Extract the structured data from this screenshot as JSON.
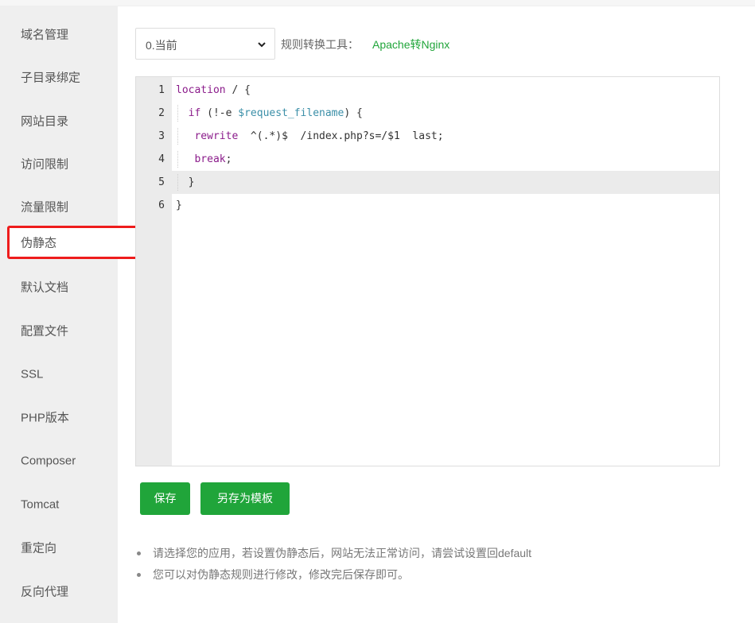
{
  "sidebar": {
    "items": [
      {
        "label": "域名管理"
      },
      {
        "label": "子目录绑定"
      },
      {
        "label": "网站目录"
      },
      {
        "label": "访问限制"
      },
      {
        "label": "流量限制"
      },
      {
        "label": "伪静态",
        "active": true
      },
      {
        "label": "默认文档"
      },
      {
        "label": "配置文件"
      },
      {
        "label": "SSL"
      },
      {
        "label": "PHP版本"
      },
      {
        "label": "Composer"
      },
      {
        "label": "Tomcat"
      },
      {
        "label": "重定向"
      },
      {
        "label": "反向代理"
      }
    ]
  },
  "toolbar": {
    "template_select_value": "0.当前",
    "chevron_icon": "chevron-down-icon",
    "tool_label": "规则转换工具：",
    "tool_link": "Apache转Nginx"
  },
  "editor": {
    "active_line": 5,
    "lines": [
      {
        "num": "1",
        "text": "location / {"
      },
      {
        "num": "2",
        "text": "  if (!-e $request_filename) {"
      },
      {
        "num": "3",
        "text": "   rewrite  ^(.*)$  /index.php?s=/$1  last;"
      },
      {
        "num": "4",
        "text": "   break;"
      },
      {
        "num": "5",
        "text": "  }"
      },
      {
        "num": "6",
        "text": "}"
      }
    ]
  },
  "buttons": {
    "save": "保存",
    "save_as_template": "另存为模板"
  },
  "notes": [
    "请选择您的应用，若设置伪静态后，网站无法正常访问，请尝试设置回default",
    "您可以对伪静态规则进行修改，修改完后保存即可。"
  ],
  "colors": {
    "accent_green": "#20a53a",
    "highlight_red": "#ee1c1c"
  }
}
